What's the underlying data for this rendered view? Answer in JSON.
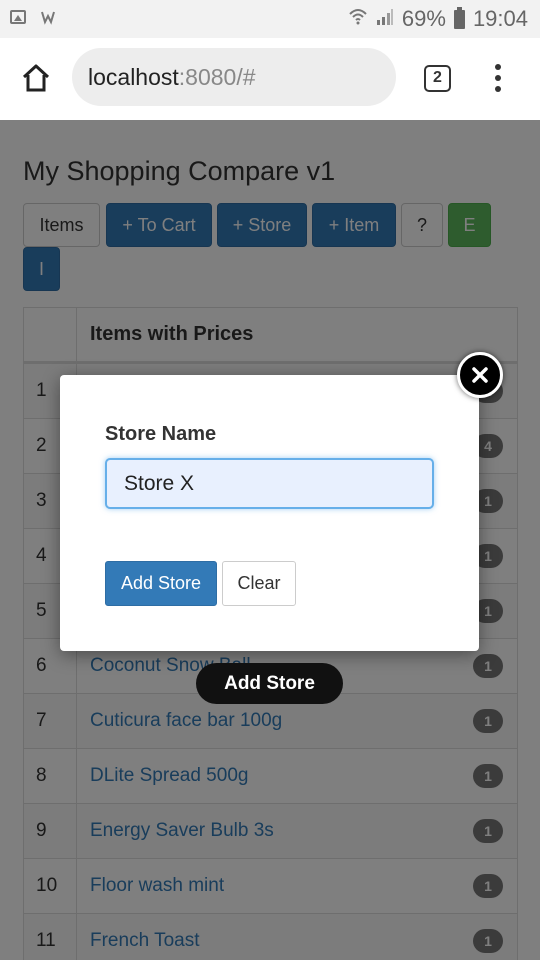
{
  "status_bar": {
    "battery_percent": "69%",
    "time": "19:04",
    "icons": [
      "image-icon",
      "notification-icon",
      "wifi-icon",
      "signal-icon",
      "battery-icon"
    ]
  },
  "browser": {
    "url_host": "localhost",
    "url_rest": ":8080/#",
    "tab_count": "2",
    "icons": [
      "home-icon",
      "overflow-menu-icon"
    ]
  },
  "app": {
    "title": "My Shopping Compare v1",
    "toolbar": {
      "items": "Items",
      "to_cart": "+ To Cart",
      "store": "+ Store",
      "item": "+ Item",
      "help": "?",
      "export": "E",
      "import": "I"
    },
    "table": {
      "header": "Items with Prices",
      "rows": [
        {
          "index": "1",
          "name": "",
          "count": "1"
        },
        {
          "index": "2",
          "name": "",
          "count": "4"
        },
        {
          "index": "3",
          "name": "",
          "count": "1"
        },
        {
          "index": "4",
          "name": "",
          "count": "1"
        },
        {
          "index": "5",
          "name": "",
          "count": "1"
        },
        {
          "index": "6",
          "name": "Coconut Snow Ball",
          "count": "1"
        },
        {
          "index": "7",
          "name": "Cuticura face bar 100g",
          "count": "1"
        },
        {
          "index": "8",
          "name": "DLite Spread 500g",
          "count": "1"
        },
        {
          "index": "9",
          "name": "Energy Saver Bulb 3s",
          "count": "1"
        },
        {
          "index": "10",
          "name": "Floor wash mint",
          "count": "1"
        },
        {
          "index": "11",
          "name": "French Toast",
          "count": "1"
        }
      ]
    }
  },
  "modal": {
    "label": "Store Name",
    "input_value": "Store X",
    "add_button": "Add Store",
    "clear_button": "Clear"
  },
  "toast": "Add Store",
  "colors": {
    "primary": "#337ab7",
    "success": "#5cb85c",
    "badge": "#777777",
    "input_focus": "#66afe9"
  }
}
